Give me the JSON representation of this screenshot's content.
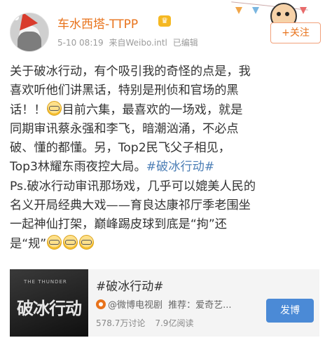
{
  "header": {
    "username": "车水西塔-TTPP",
    "timestamp": "5-10 08:19",
    "source": "来自Weibo.intl",
    "edited": "已编辑",
    "follow_label": "+关注"
  },
  "post": {
    "lines": [
      [
        "关于破冰行动，有个吸引我的奇怪的点是，我"
      ],
      [
        "喜欢听他们讲黑话，特别是刑侦和官场的黑"
      ],
      [
        "话！！",
        "{emoji}",
        "目前六集，最喜欢的一场戏，就是"
      ],
      [
        "同期审讯蔡永强和李飞，暗潮汹涌，不必点"
      ],
      [
        "破、懂的都懂。另，Top2民飞父子相见，"
      ],
      [
        "Top3林耀东雨夜控大局。",
        "{topic}"
      ],
      [
        "Ps.破冰行动审讯那场戏，几乎可以媲美人民的"
      ],
      [
        "名义开局经典大戏——育良达康祁厅季老围坐"
      ],
      [
        "一起神仙打架，巅峰踢皮球到底是“拘”还"
      ],
      [
        "是“规”",
        "{emoji}",
        "{emoji}",
        "{emoji}"
      ]
    ],
    "topic_text": "#破冰行动#",
    "emoji_name": "glasses-face-emoji"
  },
  "card": {
    "thumb_small": "THE THUNDER",
    "thumb_big": "破冰行动",
    "title": "#破冰行动#",
    "source": "@微博电视剧",
    "recommend": "推荐：爱奇艺...",
    "discussions": "578.7万讨论",
    "reads": "7.9亿阅读",
    "post_label": "发博"
  },
  "colors": {
    "username": "#e8731c",
    "topic_link": "#4d7fb6",
    "post_button": "#4b8ad6"
  }
}
